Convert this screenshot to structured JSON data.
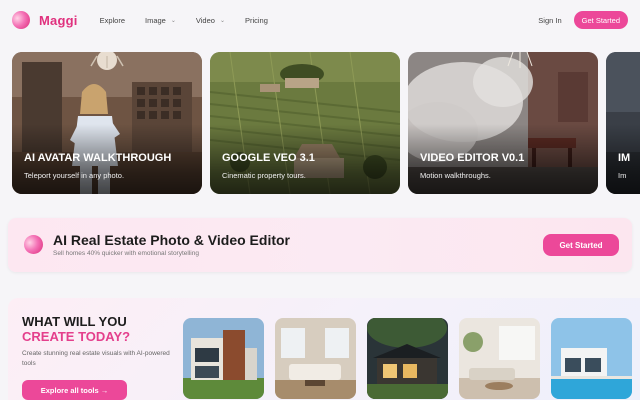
{
  "nav": {
    "brand": "Maggi",
    "links": [
      {
        "label": "Explore",
        "has_dropdown": false
      },
      {
        "label": "Image",
        "has_dropdown": true
      },
      {
        "label": "Video",
        "has_dropdown": true
      },
      {
        "label": "Pricing",
        "has_dropdown": false
      }
    ],
    "sign_in": "Sign In",
    "get_started": "Get Started"
  },
  "cards": [
    {
      "title": "AI AVATAR WALKTHROUGH",
      "subtitle": "Teleport yourself in any photo."
    },
    {
      "title": "GOOGLE VEO 3.1",
      "subtitle": "Cinematic property tours."
    },
    {
      "title": "VIDEO EDITOR V0.1",
      "subtitle": "Motion walkthroughs."
    },
    {
      "title": "IM",
      "subtitle": "Im"
    }
  ],
  "banner": {
    "title": "AI Real Estate Photo & Video Editor",
    "subtitle": "Sell homes 40% quicker with emotional storytelling",
    "button": "Get Started"
  },
  "tools": {
    "heading_line1": "WHAT WILL YOU",
    "heading_line2": "CREATE TODAY?",
    "description": "Create stunning real estate visuals with AI-powered tools",
    "button": "Explore all tools →"
  },
  "colors": {
    "accent": "#ec4899",
    "brand": "#e0317e",
    "heading_accent": "#e43f8c"
  }
}
